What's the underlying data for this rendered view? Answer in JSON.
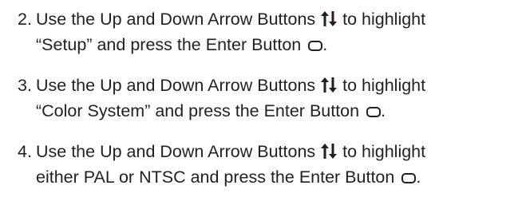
{
  "steps": [
    {
      "number": "2.",
      "line1_before_icon": "Use the Up and Down Arrow Buttons ",
      "line1_after_icon": " to highlight",
      "line2_text": "“Setup” and press the Enter Button ",
      "line2_end": "."
    },
    {
      "number": "3.",
      "line1_before_icon": "Use the Up and Down Arrow Buttons ",
      "line1_after_icon": " to highlight",
      "line2_text": "“Color System” and press the Enter Button ",
      "line2_end": "."
    },
    {
      "number": "4.",
      "line1_before_icon": "Use the Up and Down Arrow Buttons ",
      "line1_after_icon": " to highlight",
      "line2_text": "either PAL or NTSC and press the Enter Button ",
      "line2_end": "."
    }
  ],
  "icons": {
    "arrows": "up-down-arrows-icon",
    "enter": "enter-button-icon"
  },
  "colors": {
    "text": "#231f20"
  }
}
